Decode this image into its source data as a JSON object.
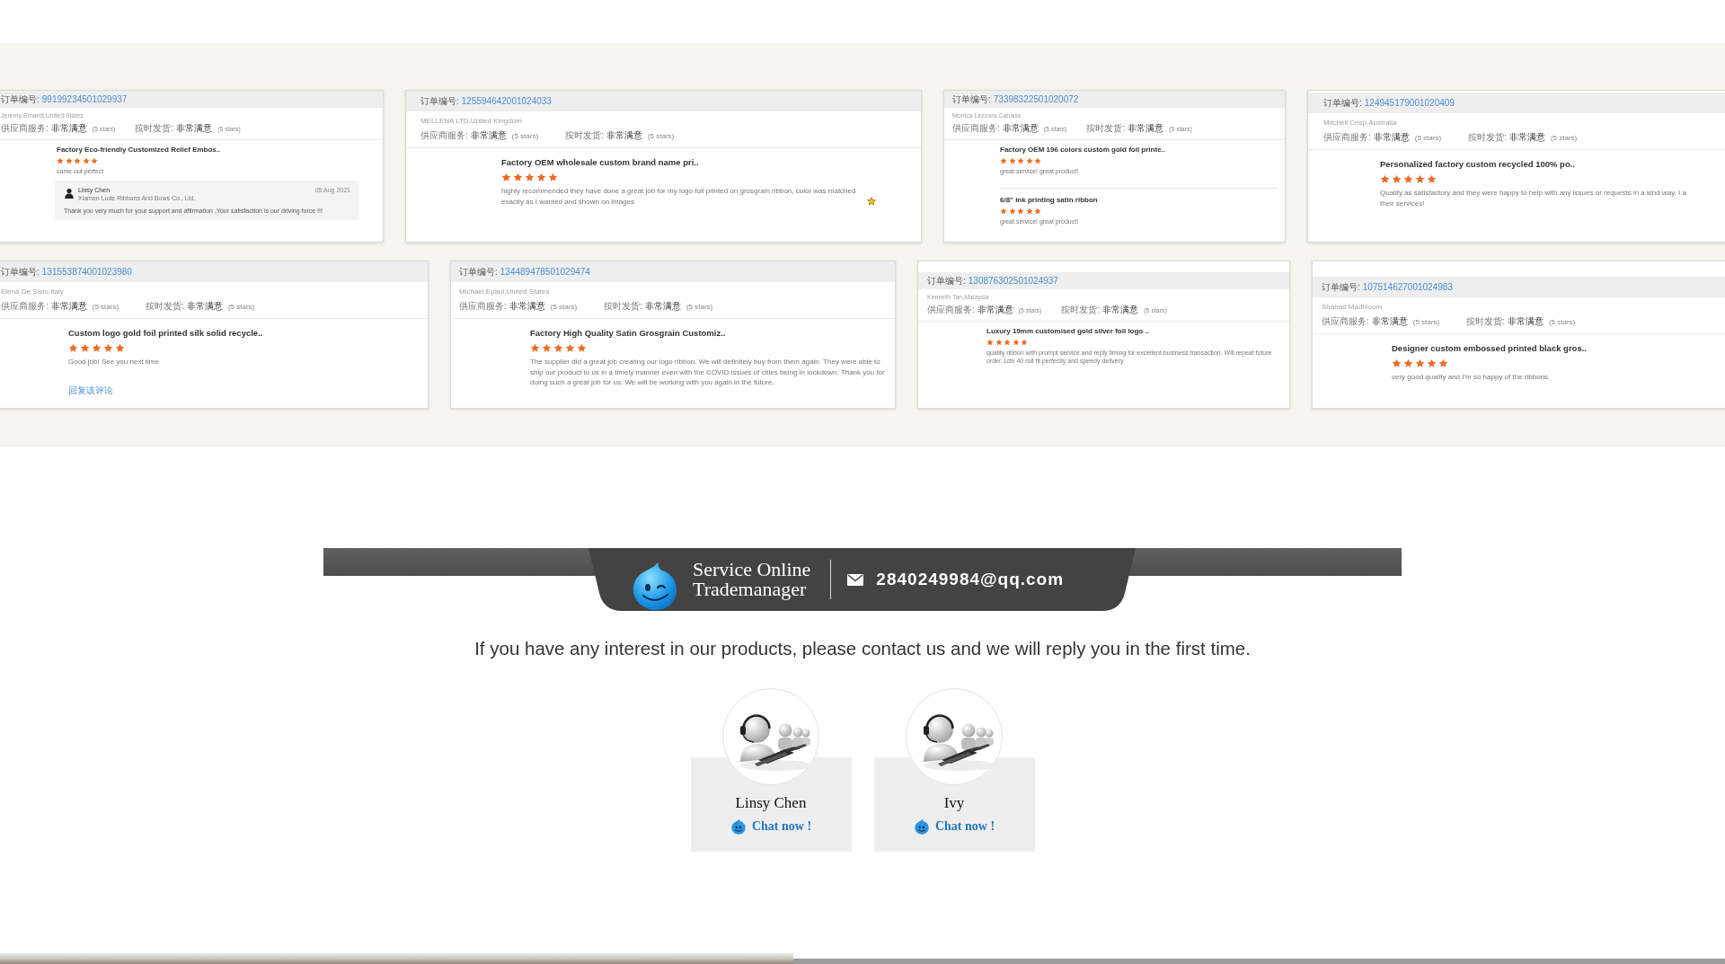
{
  "review_rows": [
    [
      {
        "order_label": "订单编号:",
        "order_no": "99199234501029937",
        "buyer": "Jeremy Erhardt,United States",
        "ratings": [
          {
            "label": "供应商服务:",
            "value": "非常满意",
            "note": "(5 stars)"
          },
          {
            "label": "按时发货:",
            "value": "非常满意",
            "note": "(5 stars)"
          }
        ],
        "items": [
          {
            "title": "Factory Eco-friendly Customized Relief Embos..",
            "stars": 5,
            "comment": "came out perfect"
          }
        ],
        "reply": {
          "name": "Linsy Chen",
          "company": "Xiamen Lude Ribbons And Bows Co., Ltd.",
          "date": "05 Aug 2021",
          "message": "Thank you very much for your support and affirmation ,Your satisfaction is our driving force !!!"
        }
      },
      {
        "order_label": "订单编号:",
        "order_no": "125594642001024033",
        "buyer": "MELLENA LTD,United Kingdom",
        "ratings": [
          {
            "label": "供应商服务:",
            "value": "非常满意",
            "note": "(5 stars)"
          },
          {
            "label": "按时发货:",
            "value": "非常满意",
            "note": "(5 stars)"
          }
        ],
        "items": [
          {
            "title": "Factory OEM wholesale custom brand name pri..",
            "stars": 5,
            "comment": "highly recommended they have done a great job for my logo foil printed on grosgrain ribbon, color was matched exactly as I wanted and shown on images",
            "emoji": true
          }
        ]
      },
      {
        "order_label": "订单编号:",
        "order_no": "73398322501020072",
        "buyer": "Monica Lezzara,Canada",
        "ratings": [
          {
            "label": "供应商服务:",
            "value": "非常满意",
            "note": "(5 stars)"
          },
          {
            "label": "按时发货:",
            "value": "非常满意",
            "note": "(5 stars)"
          }
        ],
        "items": [
          {
            "title": "Factory OEM 196 colors custom gold foil printe..",
            "stars": 5,
            "comment": "great service! great product!"
          },
          {
            "title": "6/8\" ink printing satin ribbon",
            "stars": 5,
            "comment": "great service! great product!"
          }
        ]
      },
      {
        "order_label": "订单编号:",
        "order_no": "124945179001020409",
        "buyer": "Mitchell Crisp,Australia",
        "ratings": [
          {
            "label": "供应商服务:",
            "value": "非常满意",
            "note": "(5 stars)"
          },
          {
            "label": "按时发货:",
            "value": "非常满意",
            "note": "(5 stars)"
          }
        ],
        "items": [
          {
            "title": "Personalized factory custom recycled 100% po..",
            "stars": 5,
            "comment_lines": [
              "Quality as satisfactory and they were happy to help with any issues or requests in a kind way. I a",
              "their services!"
            ]
          }
        ]
      }
    ],
    [
      {
        "order_label": "订单编号:",
        "order_no": "131553874001023980",
        "buyer": "Elena De Sisto,Italy",
        "ratings": [
          {
            "label": "供应商服务:",
            "value": "非常满意",
            "note": "(5 stars)"
          },
          {
            "label": "按时发货:",
            "value": "非常满意",
            "note": "(5 stars)"
          }
        ],
        "items": [
          {
            "title": "Custom logo gold foil printed silk solid recycle..",
            "stars": 5,
            "comment": "Good job! See you next time"
          }
        ],
        "reply_link": "回复该评论"
      },
      {
        "order_label": "订单编号:",
        "order_no": "134489478501029474",
        "buyer": "Michael Epaul,United States",
        "ratings": [
          {
            "label": "供应商服务:",
            "value": "非常满意",
            "note": "(5 stars)"
          },
          {
            "label": "按时发货:",
            "value": "非常满意",
            "note": "(5 stars)"
          }
        ],
        "items": [
          {
            "title": "Factory High Quality Satin Grosgrain Customiz..",
            "stars": 5,
            "comment": "The supplier did a great job creating our logo ribbon. We will definitely buy from them again. They were able to ship our product to us in a timely manner even with the COVID issues of cities being in lockdown. Thank you for doing such a great job for us. We will be working with you again in the future."
          }
        ]
      },
      {
        "order_label": "订单编号:",
        "order_no": "130876302501024937",
        "buyer": "Kenneth Tan,Malaysia",
        "ratings": [
          {
            "label": "供应商服务:",
            "value": "非常满意",
            "note": "(5 stars)"
          },
          {
            "label": "按时发货:",
            "value": "非常满意",
            "note": "(5 stars)"
          }
        ],
        "items": [
          {
            "title": "Luxury 19mm customised gold silver foil logo ..",
            "stars": 5,
            "comment": "quality ribbon with prompt service and reply timing for excellent business transaction. Will repeat future order 1ctn 40 roll fit perfectly and speedy delivery"
          }
        ]
      },
      {
        "order_label": "订单编号:",
        "order_no": "107514627001024983",
        "buyer": "Shahad Madhloum",
        "ratings": [
          {
            "label": "供应商服务:",
            "value": "非常满意",
            "note": "(5 stars)"
          },
          {
            "label": "按时发货:",
            "value": "非常满意",
            "note": "(5 stars)"
          }
        ],
        "items": [
          {
            "title": "Designer custom embossed printed black gros..",
            "stars": 5,
            "comment": "very good quality and I'm so happy of the ribbons"
          }
        ]
      }
    ]
  ],
  "contact": {
    "brand_lines": [
      "Service Online",
      "Trademanager"
    ],
    "email": "2840249984@qq.com",
    "message": "If you have any interest in our products, please contact us and we will reply you in the first time.",
    "agents": [
      {
        "name": "Linsy Chen",
        "chat_label": "Chat now !"
      },
      {
        "name": "Ivy",
        "chat_label": "Chat now !"
      }
    ]
  }
}
